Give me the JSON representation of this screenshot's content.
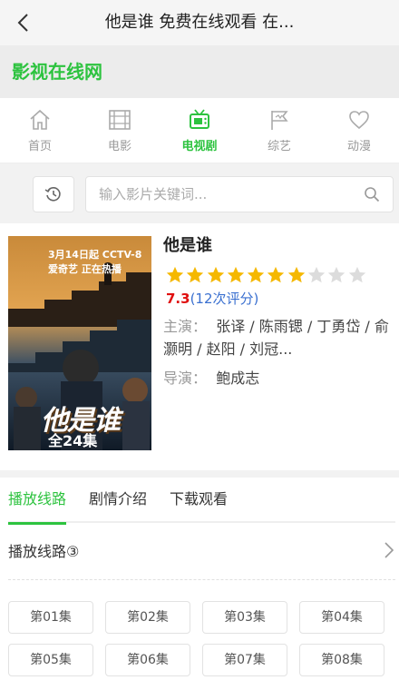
{
  "header": {
    "title": "他是谁 免费在线观看 在..."
  },
  "brand": {
    "name": "影视在线网",
    "color": "#2dc33f"
  },
  "nav": {
    "items": [
      {
        "label": "首页",
        "icon": "home-icon"
      },
      {
        "label": "电影",
        "icon": "film-icon"
      },
      {
        "label": "电视剧",
        "icon": "tv-icon",
        "active": true
      },
      {
        "label": "综艺",
        "icon": "flag-icon"
      },
      {
        "label": "动漫",
        "icon": "heart-icon"
      }
    ]
  },
  "search": {
    "placeholder": "输入影片关键词...",
    "value": ""
  },
  "poster": {
    "top_text": "3月14日起 CCTV-8 爱奇艺 正在热播",
    "title_text": "他是谁",
    "episodes_text": "全24集"
  },
  "show": {
    "title": "他是谁",
    "rating": {
      "score": "7.3",
      "count_text": "(12次评分)",
      "stars_filled": 7,
      "stars_total": 10
    },
    "cast_label": "主演：",
    "cast_value": "张译 / 陈雨锶 / 丁勇岱 / 俞灏明 / 赵阳 / 刘冠...",
    "director_label": "导演：",
    "director_value": "鲍成志"
  },
  "tabs": [
    {
      "label": "播放线路",
      "active": true
    },
    {
      "label": "剧情介绍"
    },
    {
      "label": "下载观看"
    }
  ],
  "route": {
    "label": "播放线路③"
  },
  "episodes": [
    "第01集",
    "第02集",
    "第03集",
    "第04集",
    "第05集",
    "第06集",
    "第07集",
    "第08集"
  ],
  "colors": {
    "accent": "#2dc33f",
    "star": "#f5b800",
    "score": "#e01010",
    "count": "#3a70d0"
  }
}
